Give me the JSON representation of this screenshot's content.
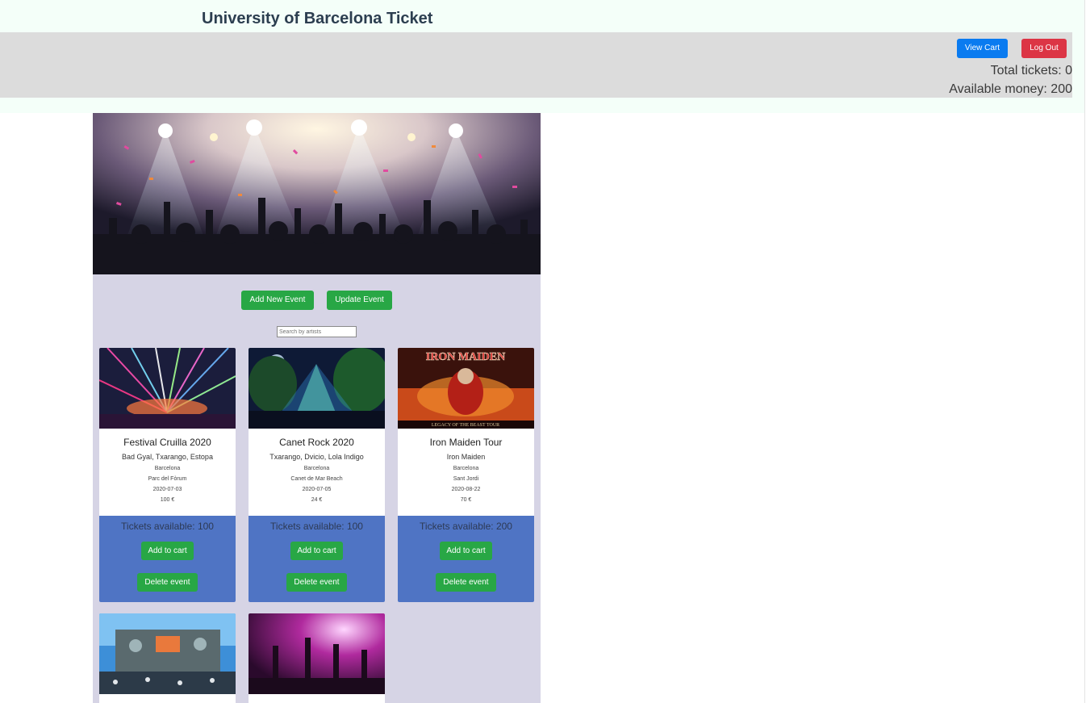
{
  "header": {
    "title": "University of Barcelona Ticket",
    "view_cart_label": "View Cart",
    "logout_label": "Log Out",
    "total_tickets": "Total tickets: 0",
    "available_money": "Available money: 200"
  },
  "actions": {
    "add_event_label": "Add New Event",
    "update_event_label": "Update Event",
    "search_placeholder": "Search by artists"
  },
  "events": [
    {
      "name": "Festival Cruilla 2020",
      "artists": "Bad Gyal, Txarango, Estopa",
      "city": "Barcelona",
      "place": "Parc del Fòrum",
      "date": "2020-07-03",
      "price": "100 €",
      "tickets": "Tickets available: 100",
      "add_label": "Add to cart",
      "delete_label": "Delete event"
    },
    {
      "name": "Canet Rock 2020",
      "artists": "Txarango, Dvicio, Lola Indigo",
      "city": "Barcelona",
      "place": "Canet de Mar Beach",
      "date": "2020-07-05",
      "price": "24 €",
      "tickets": "Tickets available: 100",
      "add_label": "Add to cart",
      "delete_label": "Delete event"
    },
    {
      "name": "Iron Maiden Tour",
      "artists": "Iron Maiden",
      "city": "Barcelona",
      "place": "Sant Jordi",
      "date": "2020-08-22",
      "price": "70 €",
      "tickets": "Tickets available: 200",
      "add_label": "Add to cart",
      "delete_label": "Delete event"
    }
  ],
  "poster": {
    "band_logo": "IRON MAIDEN",
    "tour_line": "LEGACY OF THE BEAST TOUR"
  },
  "colors": {
    "header_bg": "#f4fff9",
    "topbar_bg": "#dcdcdc",
    "main_bg": "#d6d4e5",
    "card_footer": "#4f74c4",
    "primary": "#0a7bf0",
    "danger": "#dc3545",
    "success": "#28a745"
  }
}
